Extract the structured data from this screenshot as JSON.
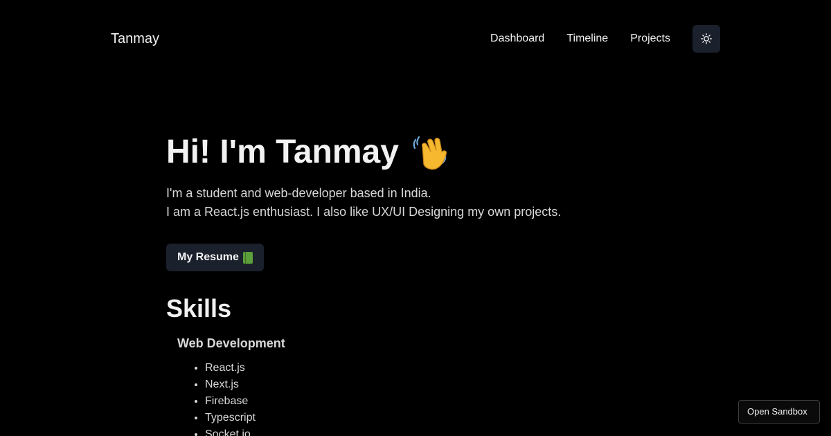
{
  "header": {
    "brand": "Tanmay",
    "nav": [
      {
        "label": "Dashboard"
      },
      {
        "label": "Timeline"
      },
      {
        "label": "Projects"
      }
    ],
    "theme_toggle_icon": "sun-icon"
  },
  "hero": {
    "title": "Hi! I'm Tanmay",
    "title_emoji_icon": "waving-hand-icon",
    "line1": "I'm a student and web-developer based in India.",
    "line2": "I am a React.js enthusiast. I also like UX/UI Designing my own projects.",
    "resume_label": "My Resume",
    "resume_emoji_icon": "green-book-icon"
  },
  "skills": {
    "title": "Skills",
    "category": "Web Development",
    "items": [
      "React.js",
      "Next.js",
      "Firebase",
      "Typescript",
      "Socket.io"
    ]
  },
  "sandbox": {
    "label": "Open Sandbox"
  },
  "colors": {
    "background": "#000000",
    "button_bg": "#1a202c",
    "text": "#f2f2f2",
    "muted_text": "#d8d8d8"
  }
}
